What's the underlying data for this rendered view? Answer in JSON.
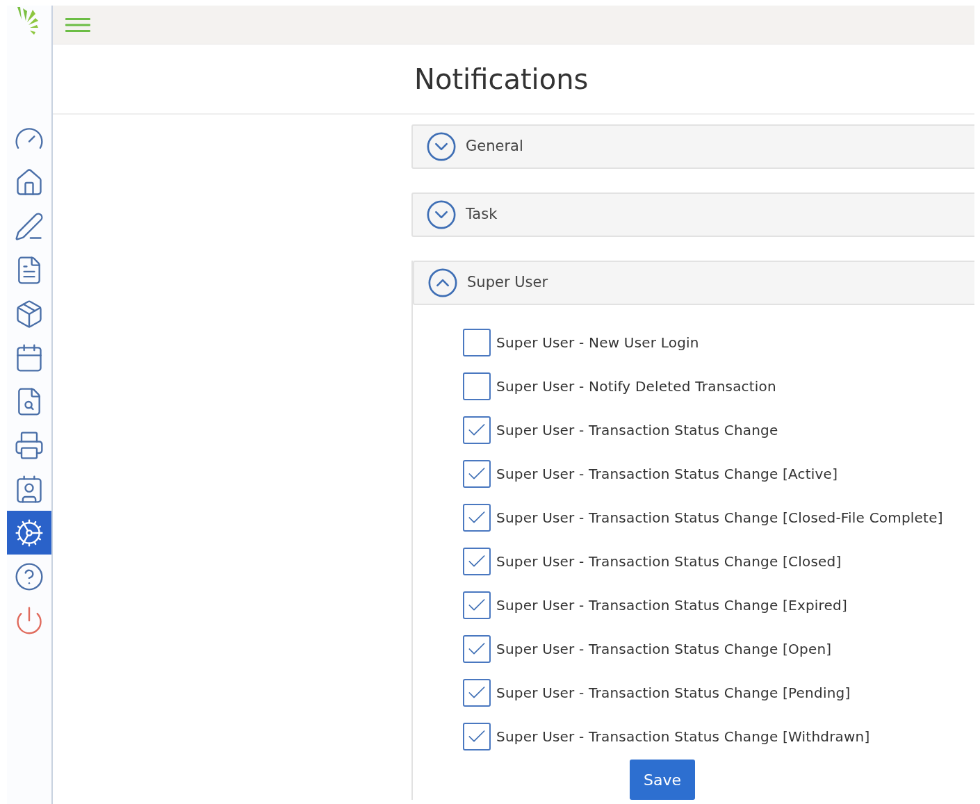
{
  "sidebar": {
    "items": [
      {
        "selected": false
      },
      {
        "selected": false
      },
      {
        "selected": false
      },
      {
        "selected": false
      },
      {
        "selected": false
      },
      {
        "selected": false
      },
      {
        "selected": false
      },
      {
        "selected": false
      },
      {
        "selected": false
      },
      {
        "selected": true
      },
      {
        "selected": false
      },
      {
        "selected": false
      }
    ]
  },
  "page": {
    "title": "Notifications"
  },
  "sections": [
    {
      "title": "General",
      "expanded": false
    },
    {
      "title": "Task",
      "expanded": false
    },
    {
      "title": "Super User",
      "expanded": true,
      "options": [
        {
          "label": "Super User - New User Login",
          "checked": false
        },
        {
          "label": "Super User - Notify Deleted Transaction",
          "checked": false
        },
        {
          "label": "Super User - Transaction Status Change",
          "checked": true
        },
        {
          "label": "Super User - Transaction Status Change [Active]",
          "checked": true
        },
        {
          "label": "Super User - Transaction Status Change [Closed-File Complete]",
          "checked": true
        },
        {
          "label": "Super User - Transaction Status Change [Closed]",
          "checked": true
        },
        {
          "label": "Super User - Transaction Status Change [Expired]",
          "checked": true
        },
        {
          "label": "Super User - Transaction Status Change [Open]",
          "checked": true
        },
        {
          "label": "Super User - Transaction Status Change [Pending]",
          "checked": true
        },
        {
          "label": "Super User - Transaction Status Change [Withdrawn]",
          "checked": true
        }
      ],
      "save": "Save"
    }
  ]
}
